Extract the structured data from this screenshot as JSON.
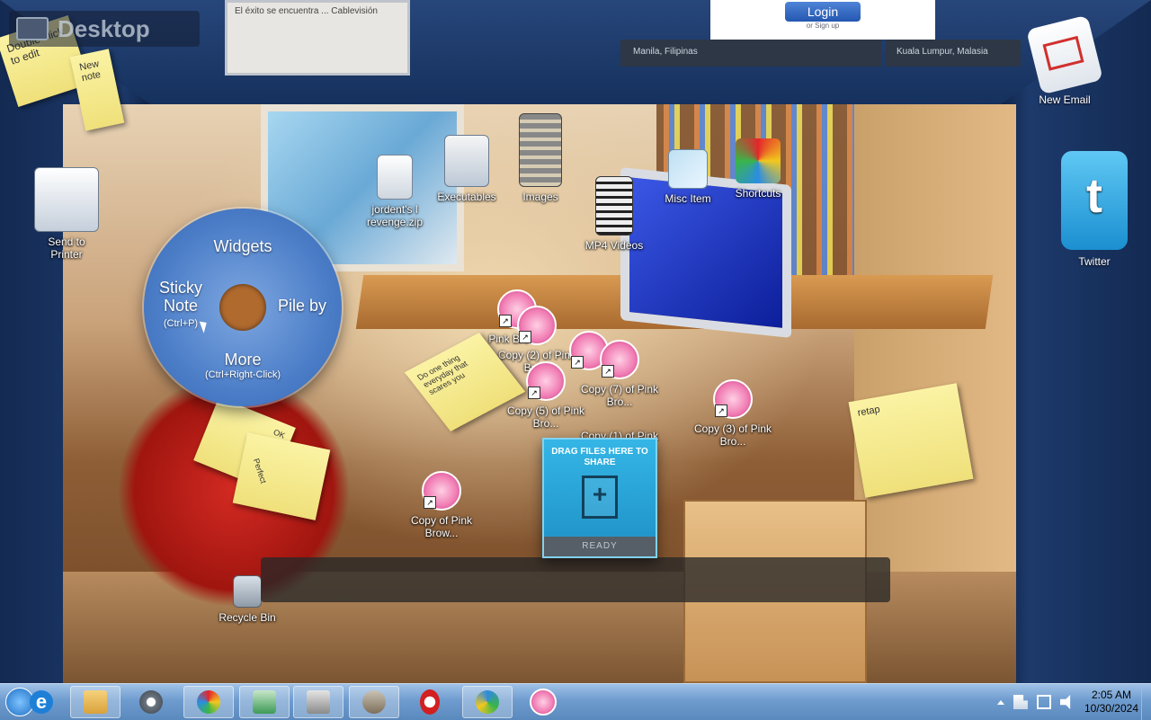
{
  "desktop_label": "Desktop",
  "ceiling": {
    "card1_text": "El éxito se encuentra ... Cablevisión",
    "login_button": "Login",
    "signup_text": "or Sign up",
    "caption_left": "Manila, Filipinas",
    "caption_right": "Kuala Lumpur, Malasia"
  },
  "left_wall": {
    "note1": "Double-click to edit",
    "note2": "New note",
    "printer_label": "Send to\nPrinter"
  },
  "icons": {
    "zip": "jordent's l revenge.zip",
    "executables": "Executables",
    "images": "Images",
    "mp4": "MP4 Videos",
    "misc": "Misc Item",
    "shortcuts": "Shortcuts",
    "copy_pink": "Copy of Pink Brow...",
    "copy2": "Copy (2) of Pink Bro...",
    "copy3": "Copy (3) of Pink Bro...",
    "copy5": "Copy (5) of Pink Bro...",
    "copy7": "Copy (7) of Pink Bro...",
    "copy1": "Copy (1) of Pink Bro...",
    "pink": "Pink Brow...",
    "recycle": "Recycle Bin"
  },
  "radial_menu": {
    "widgets": "Widgets",
    "sticky_note": "Sticky Note",
    "sticky_shortcut": "(Ctrl+P)",
    "pile_by": "Pile by",
    "more": "More",
    "more_shortcut": "(Ctrl+Right-Click)"
  },
  "stickies": {
    "center": "Do one thing everyday that scares you",
    "right": "retap",
    "left_a": "Perfect",
    "left_b": "OK"
  },
  "dropbox": {
    "title": "DRAG FILES HERE TO SHARE",
    "status": "READY"
  },
  "right_wall": {
    "email": "New Email",
    "twitter": "Twitter"
  },
  "taskbar": {
    "time": "2:05 AM",
    "date": "10/30/2024"
  },
  "colors": {
    "ie": "#1e7fd6",
    "explorer": "#e5b84a",
    "opera": "#d21f1f",
    "chrome_like": "#2f8ae0"
  }
}
